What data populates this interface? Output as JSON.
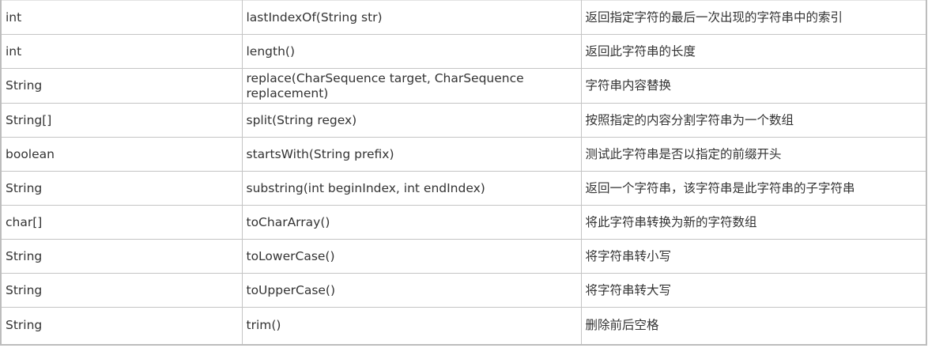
{
  "table": {
    "rows": [
      {
        "type": "int",
        "method": "lastIndexOf(String str)",
        "description": "返回指定字符的最后一次出现的字符串中的索引"
      },
      {
        "type": "int",
        "method": "length()",
        "description": "返回此字符串的长度"
      },
      {
        "type": "String",
        "method": "replace(CharSequence target, CharSequence replacement)",
        "description": "字符串内容替换"
      },
      {
        "type": "String[]",
        "method": "split(String regex)",
        "description": "按照指定的内容分割字符串为一个数组"
      },
      {
        "type": "boolean",
        "method": "startsWith(String prefix)",
        "description": "测试此字符串是否以指定的前缀开头"
      },
      {
        "type": "String",
        "method": "substring(int beginIndex, int endIndex)",
        "description": "返回一个字符串，该字符串是此字符串的子字符串"
      },
      {
        "type": "char[]",
        "method": "toCharArray()",
        "description": "将此字符串转换为新的字符数组"
      },
      {
        "type": "String",
        "method": "toLowerCase()",
        "description": "将字符串转小写"
      },
      {
        "type": "String",
        "method": "toUpperCase()",
        "description": "将字符串转大写"
      },
      {
        "type": "String",
        "method": "trim()",
        "description": "删除前后空格"
      }
    ]
  }
}
